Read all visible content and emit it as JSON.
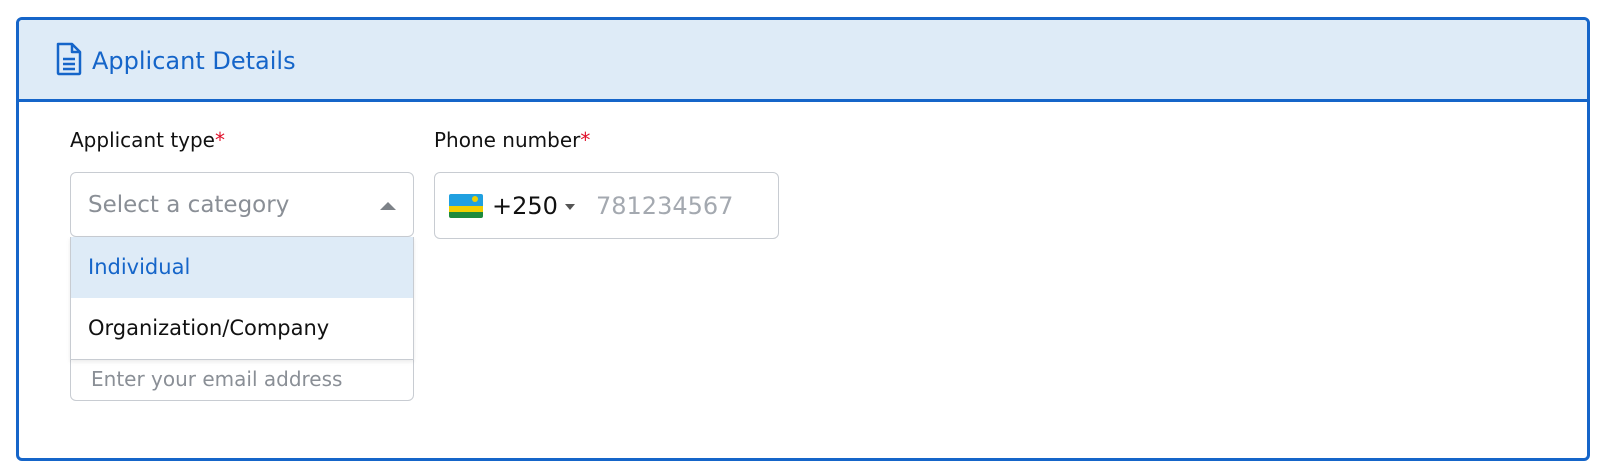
{
  "section": {
    "title": "Applicant Details",
    "icon": "document-icon",
    "accent_color": "#1565c9",
    "header_background": "#deebf7"
  },
  "fields": {
    "applicant_type": {
      "label": "Applicant type",
      "required_mark": "*",
      "placeholder": "Select a category",
      "options": [
        "Individual",
        "Organization/Company"
      ],
      "highlighted_option": "Individual",
      "dropdown_open": true
    },
    "phone": {
      "label": "Phone number",
      "required_mark": "*",
      "country_flag": "rwanda-flag-icon",
      "dial_code": "+250",
      "placeholder": "781234567"
    },
    "email": {
      "placeholder": "Enter your email address"
    }
  },
  "colors": {
    "required": "#e0102a",
    "placeholder": "#8a8f96",
    "highlight_bg": "#deebf7"
  }
}
